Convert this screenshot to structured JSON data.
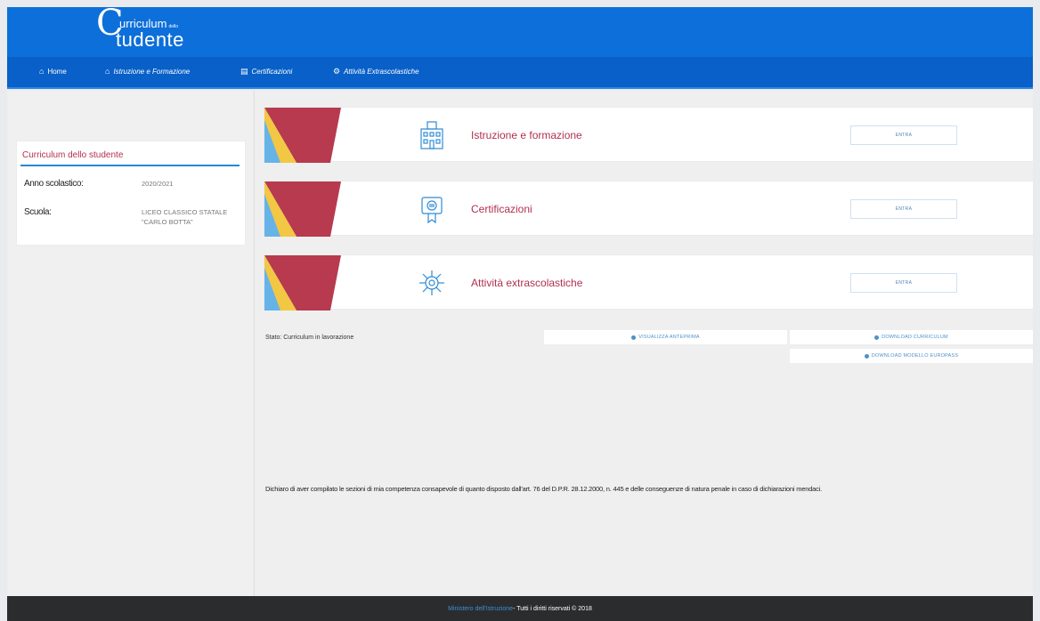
{
  "logo": {
    "initial": "C",
    "line1": "urriculum",
    "line1_small": "dello",
    "line2": "tudente"
  },
  "nav": [
    {
      "label": "Home",
      "icon": "home-icon"
    },
    {
      "label": "Istruzione e Formazione",
      "icon": "school-icon"
    },
    {
      "label": "Certificazioni",
      "icon": "certificate-icon"
    },
    {
      "label": "Attività Extrascolastiche",
      "icon": "gear-icon"
    }
  ],
  "infocard": {
    "title": "Curriculum dello studente",
    "anno_label": "Anno scolastico:",
    "anno_value": "2020/2021",
    "scuola_label": "Scuola:",
    "scuola_value": "LICEO CLASSICO STATALE \"CARLO BOTTA\""
  },
  "cards": [
    {
      "title": "Istruzione e formazione",
      "button": "ENTRA",
      "icon": "school-building-icon"
    },
    {
      "title": "Certificazioni",
      "button": "ENTRA",
      "icon": "certificate-icon"
    },
    {
      "title": "Attività extrascolastiche",
      "button": "ENTRA",
      "icon": "virus-gear-icon"
    }
  ],
  "status": {
    "text": "Stato: Curriculum in lavorazione"
  },
  "actions": {
    "anteprima": "VISUALIZZA ANTEPRIMA",
    "download": "DOWNLOAD CURRICULUM",
    "europass": "DOWNLOAD MODELLO EUROPASS"
  },
  "declaration": "Dichiaro di aver compilato le sezioni di mia competenza consapevole di quanto disposto dall'art. 76 del D.P.R. 28.12.2000, n. 445 e delle conseguenze di natura penale in caso di dichiarazioni mendaci.",
  "footer": {
    "ministry": "Ministero dell'Istruzione",
    "rights": " - Tutti i diritti riservati © 2018"
  },
  "colors": {
    "header_blue": "#0d6fd9",
    "nav_blue": "#0860c8",
    "accent_red": "#b03050",
    "footer_dark": "#2b2c2e"
  }
}
